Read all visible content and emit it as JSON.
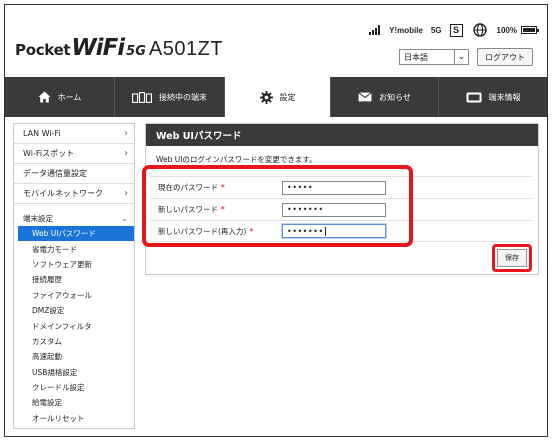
{
  "header": {
    "logo_pocket": "Pocket",
    "logo_wifi": "WiFi",
    "logo_5g": "5G",
    "logo_model": "A501ZT",
    "status": {
      "carrier": "Y!mobile",
      "network": "5G",
      "sim_label": "S",
      "battery": "100%",
      "battery_level": 1.0
    },
    "language": "日本語",
    "logout_label": "ログアウト"
  },
  "nav": {
    "tabs": [
      {
        "label": "ホーム",
        "icon": "home-icon",
        "active": false
      },
      {
        "label": "接続中の端末",
        "icon": "devices-icon",
        "active": false
      },
      {
        "label": "設定",
        "icon": "gear-icon",
        "active": true
      },
      {
        "label": "お知らせ",
        "icon": "mail-icon",
        "active": false
      },
      {
        "label": "端末情報",
        "icon": "device-info-icon",
        "active": false
      }
    ]
  },
  "sidebar": {
    "items": [
      {
        "label": "LAN Wi-Fi"
      },
      {
        "label": "Wi-Fiスポット"
      },
      {
        "label": "データ通信量設定"
      },
      {
        "label": "モバイルネットワーク"
      }
    ],
    "group_label": "端末設定",
    "sub_items": [
      {
        "label": "Web UIパスワード",
        "active": true
      },
      {
        "label": "省電力モード"
      },
      {
        "label": "ソフトウェア更新"
      },
      {
        "label": "接続履歴"
      },
      {
        "label": "ファイアウォール"
      },
      {
        "label": "DMZ設定"
      },
      {
        "label": "ドメインフィルタ"
      },
      {
        "label": "カスタム"
      },
      {
        "label": "高速起動"
      },
      {
        "label": "USB規格設定"
      },
      {
        "label": "クレードル設定"
      },
      {
        "label": "給電設定"
      },
      {
        "label": "オールリセット"
      }
    ]
  },
  "panel": {
    "title": "Web UIパスワード",
    "description": "Web UIのログインパスワードを変更できます。",
    "fields": [
      {
        "label": "現在のパスワード",
        "required": "*",
        "value": "•••••"
      },
      {
        "label": "新しいパスワード",
        "required": "*",
        "value": "•••••••"
      },
      {
        "label": "新しいパスワード(再入力)",
        "required": "*",
        "value": "•••••••"
      }
    ],
    "save_label": "保存"
  },
  "colors": {
    "nav_bg": "#3a3a3a",
    "active_blue": "#1a73d9",
    "highlight_red": "#e8151a"
  }
}
